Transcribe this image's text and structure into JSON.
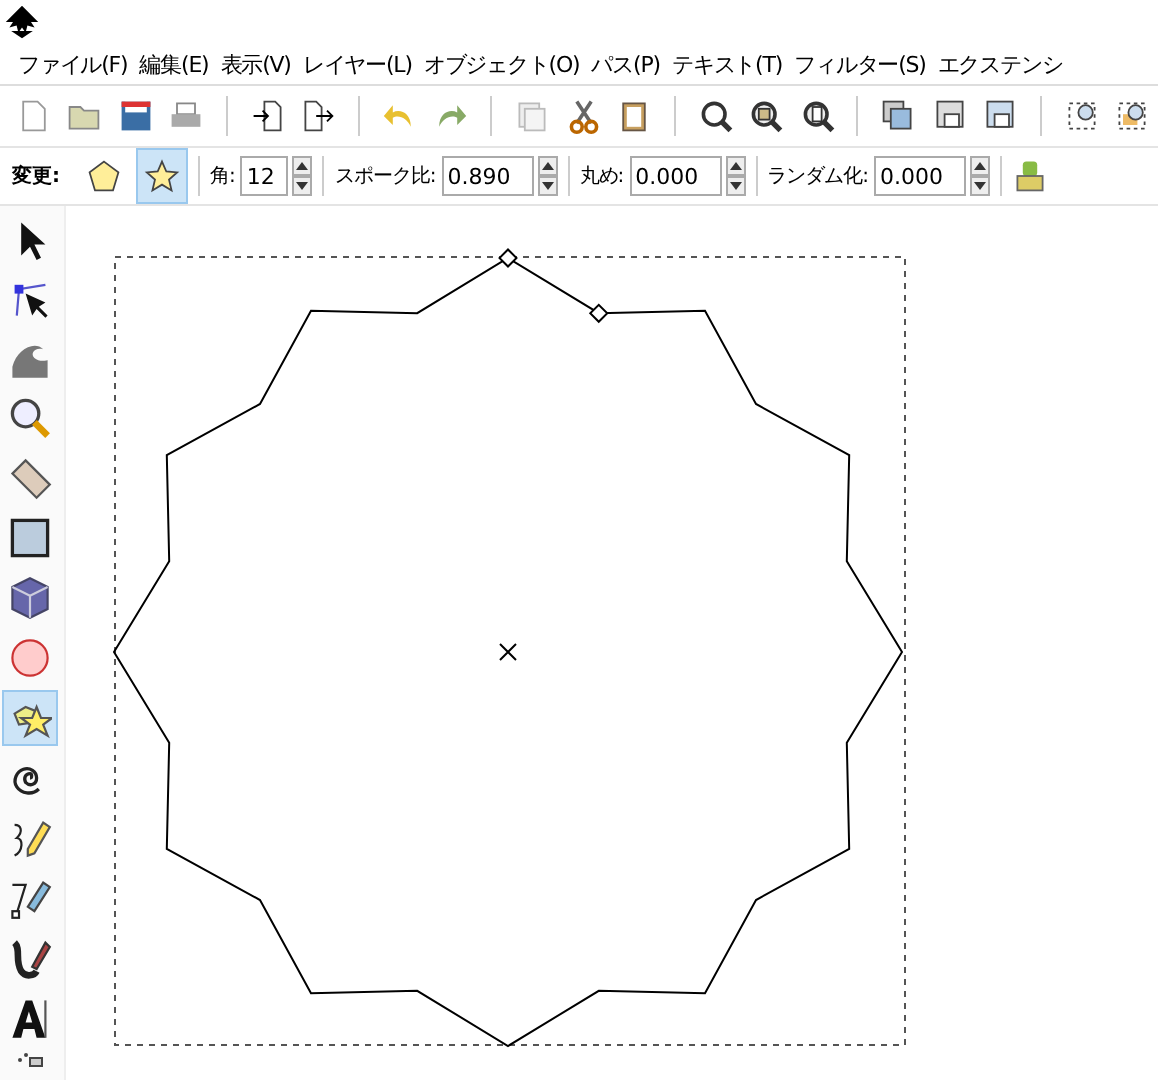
{
  "menu": [
    {
      "label": "ファイル(F)"
    },
    {
      "label": "編集(E)"
    },
    {
      "label": "表示(V)"
    },
    {
      "label": "レイヤー(L)"
    },
    {
      "label": "オブジェクト(O)"
    },
    {
      "label": "パス(P)"
    },
    {
      "label": "テキスト(T)"
    },
    {
      "label": "フィルター(S)"
    },
    {
      "label": "エクステンシ"
    }
  ],
  "tool_controls": {
    "label": "変更:",
    "shapes": [
      {
        "kind": "polygon",
        "selected": false
      },
      {
        "kind": "star",
        "selected": true
      }
    ],
    "fields": [
      {
        "label": "角:",
        "value": "12"
      },
      {
        "label": "スポーク比:",
        "value": "0.890"
      },
      {
        "label": "丸め:",
        "value": "0.000"
      },
      {
        "label": "ランダム化:",
        "value": "0.000"
      }
    ]
  },
  "tools": [
    {
      "kind": "selector",
      "selected": false
    },
    {
      "kind": "node",
      "selected": false
    },
    {
      "kind": "tweak",
      "selected": false
    },
    {
      "kind": "zoom",
      "selected": false
    },
    {
      "kind": "measure",
      "selected": false
    },
    {
      "kind": "rect",
      "selected": false
    },
    {
      "kind": "box3d",
      "selected": false
    },
    {
      "kind": "ellipse",
      "selected": false
    },
    {
      "kind": "star",
      "selected": true
    },
    {
      "kind": "spiral",
      "selected": false
    },
    {
      "kind": "pencil",
      "selected": false
    },
    {
      "kind": "pen",
      "selected": false
    },
    {
      "kind": "calligraphy",
      "selected": false
    },
    {
      "kind": "text",
      "selected": false
    },
    {
      "kind": "spray",
      "selected": false
    }
  ]
}
